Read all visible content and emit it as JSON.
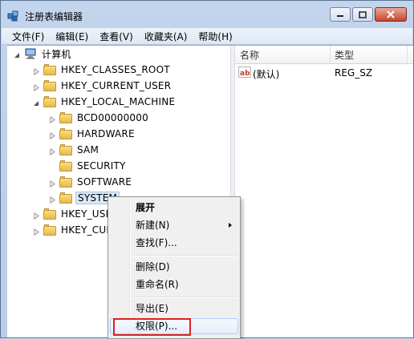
{
  "window": {
    "title": "注册表编辑器"
  },
  "menubar": {
    "items": [
      "文件(F)",
      "编辑(E)",
      "查看(V)",
      "收藏夹(A)",
      "帮助(H)"
    ]
  },
  "tree": {
    "root": "计算机",
    "nodes": [
      {
        "label": "HKEY_CLASSES_ROOT"
      },
      {
        "label": "HKEY_CURRENT_USER"
      },
      {
        "label": "HKEY_LOCAL_MACHINE"
      },
      {
        "label": "BCD00000000"
      },
      {
        "label": "HARDWARE"
      },
      {
        "label": "SAM"
      },
      {
        "label": "SECURITY"
      },
      {
        "label": "SOFTWARE"
      },
      {
        "label": "SYSTEM"
      },
      {
        "label": "HKEY_USE"
      },
      {
        "label": "HKEY_CUR"
      }
    ]
  },
  "list": {
    "columns": [
      "名称",
      "类型"
    ],
    "rows": [
      {
        "name": "(默认)",
        "type": "REG_SZ",
        "icon": "ab-string-icon"
      }
    ]
  },
  "context_menu": {
    "items": [
      {
        "label": "展开"
      },
      {
        "label": "新建(N)"
      },
      {
        "label": "查找(F)..."
      },
      {
        "label": "删除(D)"
      },
      {
        "label": "重命名(R)"
      },
      {
        "label": "导出(E)"
      },
      {
        "label": "权限(P)..."
      }
    ]
  },
  "colors": {
    "highlight_box": "#e02020",
    "selection": "#dbe8f7"
  }
}
